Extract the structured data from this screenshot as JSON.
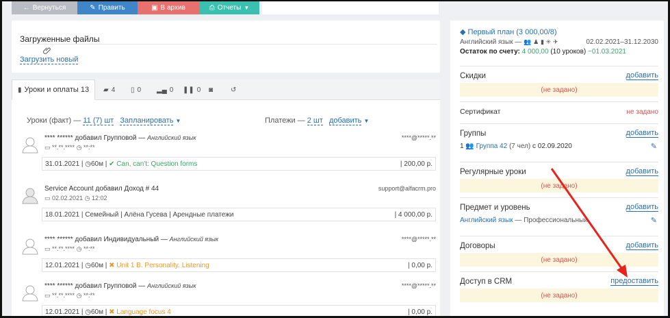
{
  "toolbar": {
    "back_label": "Вернуться",
    "edit_label": "Править",
    "archive_label": "В архив",
    "reports_label": "Отчеты"
  },
  "files": {
    "title": "Загруженные файлы",
    "upload_label": "Загрузить новый"
  },
  "tabs": [
    {
      "label": "Уроки и оплаты 13",
      "icon": "book-icon"
    },
    {
      "label": "4",
      "icon": "comments-icon"
    },
    {
      "label": "0",
      "icon": "notes-icon"
    },
    {
      "label": "0",
      "icon": "chart-icon"
    },
    {
      "label": "0",
      "icon": "pause-icon"
    },
    {
      "label": "",
      "icon": "camera-icon"
    },
    {
      "label": "",
      "icon": "history-icon"
    }
  ],
  "filters": {
    "lessons_label": "Уроки (факт) —",
    "lessons_count": "11 (7) шт",
    "planned_label": "Запланировать",
    "payments_label": "Платежи —",
    "payments_count": "2 шт",
    "add_label": "добавить"
  },
  "entries": [
    {
      "author": "**** ******",
      "action": "добавил Групповой —",
      "subject": "Английский язык",
      "date": "**.**.****",
      "time": "**:**",
      "email": "****@*****.**",
      "row_date": "31.01.2021",
      "row_duration": "60м",
      "row_topic": "Can, can't: Question forms",
      "row_status": "green",
      "row_amount": "200,00 р."
    },
    {
      "author": "Service Account",
      "action": "добавил Доход # 44",
      "subject": "",
      "date": "02.02.2021",
      "time": "12:02",
      "email": "support@alfacrm.pro",
      "row_date": "18.01.2021",
      "row_duration": "Семейный | Алёна Гусева | Арендные платежи",
      "row_topic": "",
      "row_status": "none",
      "row_amount": "4 000,00 р."
    },
    {
      "author": "**** ******",
      "action": "добавил Индивидуальный —",
      "subject": "Английский язык",
      "date": "**.**.****",
      "time": "**:**",
      "email": "****@*****.**",
      "row_date": "12.01.2021",
      "row_duration": "60м",
      "row_topic": "Unit 1 B. Personality. Listening",
      "row_status": "orange",
      "row_amount": "0,00 р."
    },
    {
      "author": "**** ******",
      "action": "добавил Групповой —",
      "subject": "Английский язык",
      "date": "**.**.****",
      "time": "**:**",
      "email": "****@*****.**",
      "row_date": "12.01.2021",
      "row_duration": "60м",
      "row_topic": "Language focus 4",
      "row_status": "orange",
      "row_amount": "0,00 р."
    }
  ],
  "plan": {
    "name": "Первый план (3 000,00/8)",
    "subject": "Английский язык —",
    "period": "02.02.2021–31.12.2030",
    "balance_label": "Остаток по счету:",
    "balance_value": "4 000,00",
    "balance_lessons": "(10 уроков)",
    "balance_date": "~01.03.2021"
  },
  "sections": {
    "discounts": {
      "title": "Скидки",
      "action": "добавить",
      "empty": "(не задано)"
    },
    "certificate": {
      "title": "Сертификат",
      "status": "не задано"
    },
    "groups": {
      "title": "Группы",
      "action": "добавить",
      "count": "1",
      "group_name": "Группа 42",
      "group_size": "(7 чел)",
      "group_since": "с 02.09.2020"
    },
    "regular": {
      "title": "Регулярные уроки",
      "action": "добавить",
      "empty": "(не задано)"
    },
    "subject": {
      "title": "Предмет и уровень",
      "action": "добавить",
      "subject_name": "Английский язык",
      "level": "— Профессиональный"
    },
    "contracts": {
      "title": "Договоры",
      "action": "добавить",
      "empty": "(не задано)"
    },
    "crm": {
      "title": "Доступ в CRM",
      "action": "предоставить",
      "empty": "(не задано)"
    }
  },
  "colors": {
    "accent": "#3f86c9",
    "danger": "#e8706f",
    "success": "#3bbfae",
    "annotation_arrow": "#e8231c"
  }
}
